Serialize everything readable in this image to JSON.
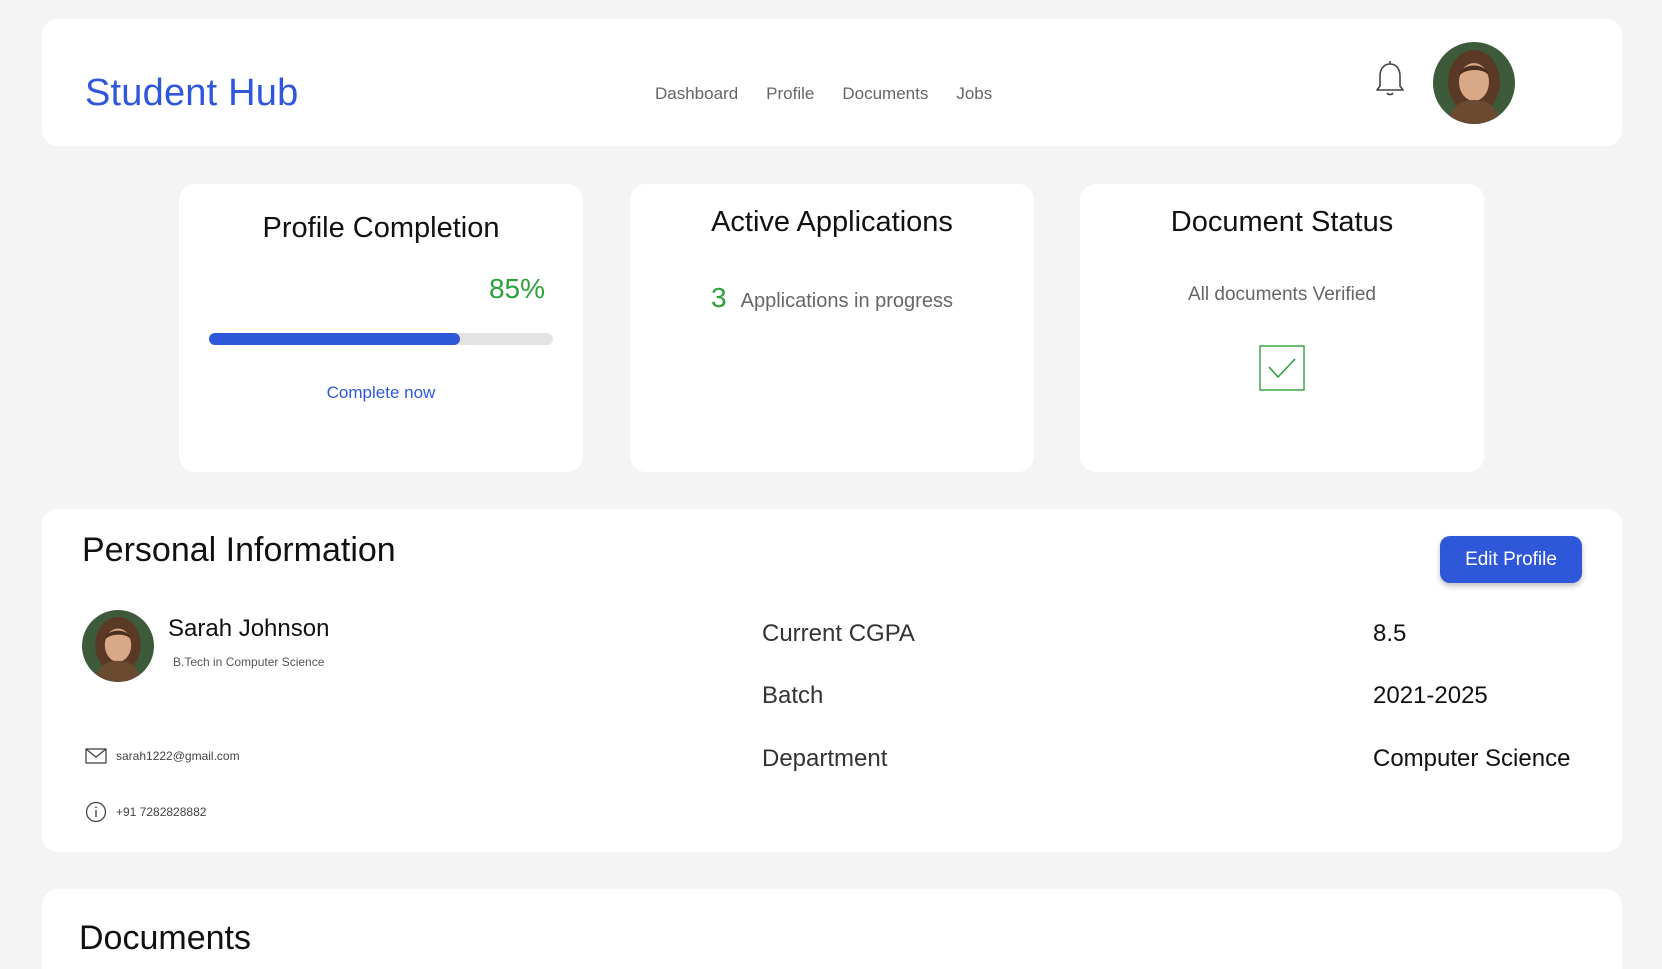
{
  "header": {
    "brand": "Student Hub",
    "nav": [
      "Dashboard",
      "Profile",
      "Documents",
      "Jobs"
    ],
    "icons": {
      "notifications": "bell-icon",
      "user": "avatar"
    }
  },
  "stats": {
    "profile": {
      "title": "Profile Completion",
      "percent_label": "85%",
      "progress": 0.73,
      "action": "Complete now"
    },
    "applications": {
      "title": "Active Applications",
      "count": "3",
      "label": "Applications in progress"
    },
    "documents": {
      "title": "Document Status",
      "status": "All documents Verified",
      "icon": "check-box-icon"
    }
  },
  "personal": {
    "title": "Personal Information",
    "edit_label": "Edit Profile",
    "name": "Sarah Johnson",
    "degree": "B.Tech in Computer Science",
    "email": "sarah1222@gmail.com",
    "phone": "+91 7282828882",
    "fields": {
      "cgpa_label": "Current CGPA",
      "cgpa_value": "8.5",
      "batch_label": "Batch",
      "batch_value": "2021-2025",
      "dept_label": "Department",
      "dept_value": "Computer Science"
    }
  },
  "documents": {
    "title": "Documents"
  },
  "colors": {
    "accent": "#2f57d9",
    "success": "#2aa23a",
    "background": "#f4f4f4"
  }
}
